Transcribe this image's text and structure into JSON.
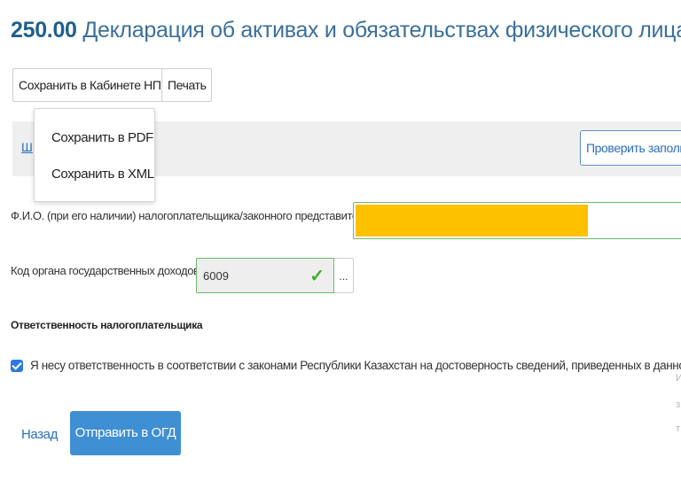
{
  "header": {
    "code": "250.00",
    "title": "Декларация об активах и обязательствах физического лица"
  },
  "toolbar": {
    "save_label": "Сохранить в Кабинете НП",
    "print_label": "Печать"
  },
  "save_menu": {
    "items": [
      "Сохранить в PDF",
      "Сохранить в XML"
    ]
  },
  "band": {
    "template_link": "Ш",
    "check_button": "Проверить заполнение"
  },
  "form": {
    "fio_label": "Ф.И.О. (при его наличии) налогоплательщика/законного представителя",
    "kod_label": "Код органа государственных доходов",
    "kod_value": "6009",
    "kod_button": "...",
    "responsibility_heading": "Ответственность налогоплательщика",
    "consent_text": "Я несу ответственность в соответствии с законами Республики Казахстан на достоверность сведений, приведенных в данной",
    "consent_checked": true
  },
  "side_fragments": [
    "И",
    "з",
    "т"
  ],
  "footer": {
    "back_label": "Назад",
    "submit_label": "Отправить в ОГД"
  },
  "colors": {
    "accent": "#3f8fd3",
    "link": "#2a6ebb",
    "valid_border": "#6cb86c",
    "redaction": "#fdc100"
  },
  "icons": {
    "caret": "chevron-down-icon",
    "valid": "checkmark-icon",
    "checkbox": "checkbox-checked-icon"
  }
}
